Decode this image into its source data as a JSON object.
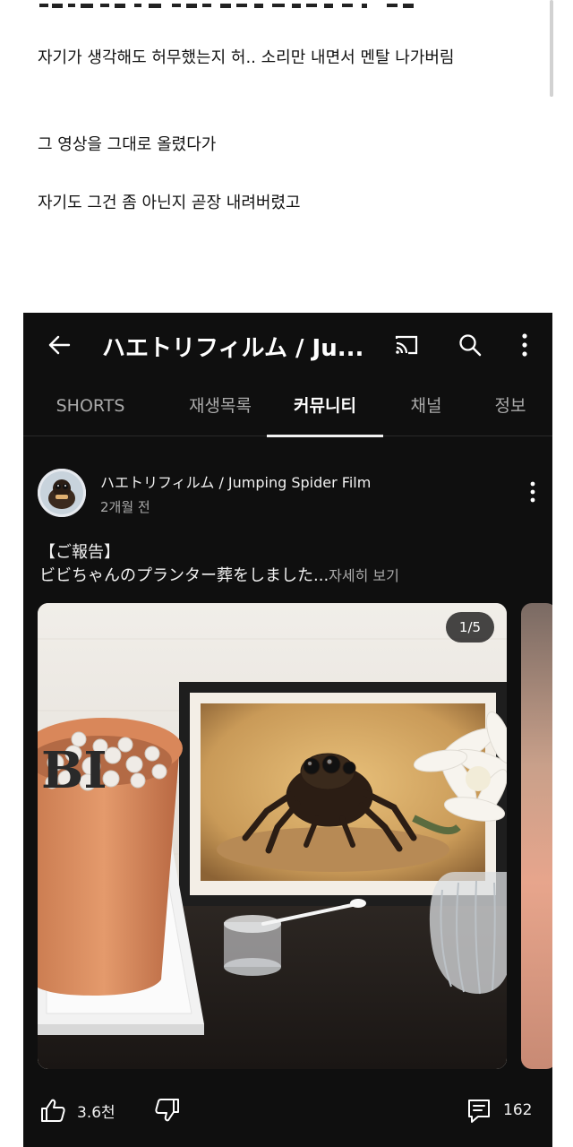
{
  "article": {
    "lines": [
      "자기가 생각해도 허무했는지 허.. 소리만 내면서 멘탈 나가버림",
      "그 영상을 그대로 올렸다가",
      "자기도 그건 좀 아닌지 곧장 내려버렸고"
    ]
  },
  "youtube": {
    "appbar": {
      "title": "ハエトリフィルム / Ju...",
      "icons": [
        "back-arrow-icon",
        "cast-icon",
        "search-icon",
        "more-vert-icon"
      ]
    },
    "tabs": [
      "SHORTS",
      "재생목록",
      "커뮤니티",
      "채널",
      "정보"
    ],
    "active_tab": "커뮤니티",
    "post": {
      "channel_name": "ハエトリフィルム / Jumping Spider Film",
      "time_ago": "2개월 전",
      "text_line1": "【ご報告】",
      "text_line2": "ビビちゃんのプランター葬をしました...",
      "more_label": "자세히 보기",
      "image_counter": "1/5",
      "likes": "3.6천",
      "comments": "162"
    },
    "colors": {
      "background": "#0f0f0f",
      "text": "#f1f1f1",
      "secondary_text": "#aaaaaa"
    }
  }
}
